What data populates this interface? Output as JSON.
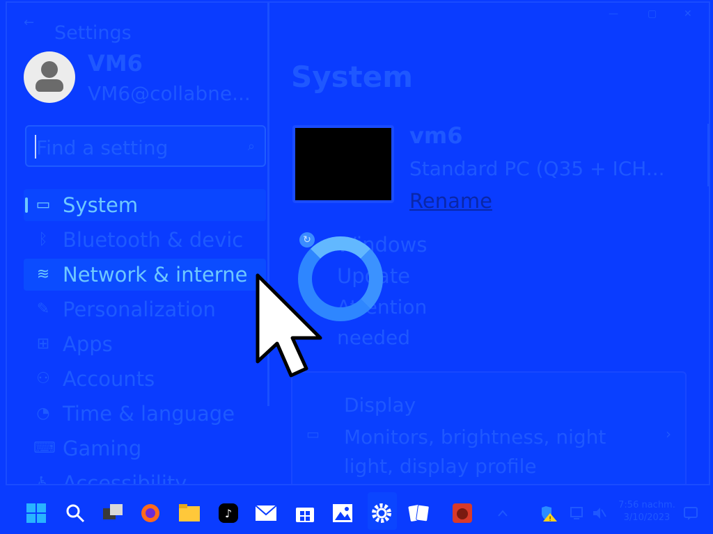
{
  "window": {
    "minimize": "—",
    "maximize": "▢",
    "close": "✕"
  },
  "sidebar": {
    "back_icon": "←",
    "app_title": "Settings",
    "user": {
      "name": "VM6",
      "email": "VM6@collabne..."
    },
    "search": {
      "placeholder": "Find a setting",
      "icon": "⌕"
    },
    "items": [
      {
        "label": "System",
        "icon": "▭"
      },
      {
        "label": "Bluetooth & devic",
        "icon": "ᛒ"
      },
      {
        "label": "Network & interne",
        "icon": "≋"
      },
      {
        "label": "Personalization",
        "icon": "✎"
      },
      {
        "label": "Apps",
        "icon": "⊞"
      },
      {
        "label": "Accounts",
        "icon": "⚇"
      },
      {
        "label": "Time & language",
        "icon": "◔"
      },
      {
        "label": "Gaming",
        "icon": "⌨"
      },
      {
        "label": "Accessibility",
        "icon": "♿"
      }
    ]
  },
  "main": {
    "title": "System",
    "device": {
      "name": "vm6",
      "model": "Standard PC (Q35 + ICH...",
      "rename": "Rename"
    },
    "update": {
      "title": "Windows Update",
      "status": "Attention needed",
      "icon": "↻"
    },
    "cards": [
      {
        "title": "Display",
        "description": "Monitors, brightness, night light, display profile",
        "icon": "▭",
        "chevron": "›"
      }
    ]
  },
  "taskbar": {
    "clock": {
      "time": "7:56 nachm.",
      "date": "3/10/2023"
    }
  }
}
